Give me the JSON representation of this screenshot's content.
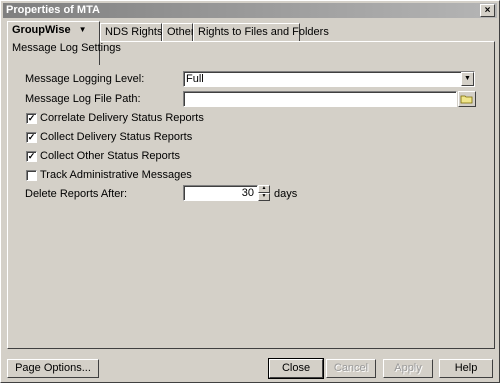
{
  "window": {
    "title": "Properties of MTA",
    "close_glyph": "×"
  },
  "tabs": [
    {
      "label": "GroupWise",
      "sub_label": "Message Log Settings",
      "has_dropdown": true,
      "active": true
    },
    {
      "label": "NDS Rights",
      "has_dropdown": true
    },
    {
      "label": "Other"
    },
    {
      "label": "Rights to Files and Folders"
    }
  ],
  "form": {
    "logging_level": {
      "label": "Message Logging Level:",
      "value": "Full"
    },
    "log_path": {
      "label": "Message Log File Path:",
      "value": ""
    },
    "checks": [
      {
        "label": "Correlate Delivery Status Reports",
        "checked": true
      },
      {
        "label": "Collect Delivery Status Reports",
        "checked": true
      },
      {
        "label": "Collect Other Status Reports",
        "checked": true
      },
      {
        "label": "Track Administrative Messages",
        "checked": false
      }
    ],
    "delete_after": {
      "label": "Delete Reports After:",
      "value": "30",
      "unit": "days"
    }
  },
  "buttons": {
    "page_options": "Page Options...",
    "close": "Close",
    "cancel": "Cancel",
    "apply": "Apply",
    "help": "Help"
  },
  "icons": {
    "dropdown": "chevron-down-icon",
    "folder": "folder-icon",
    "spin_up": "spin-up-icon",
    "spin_down": "spin-down-icon"
  }
}
